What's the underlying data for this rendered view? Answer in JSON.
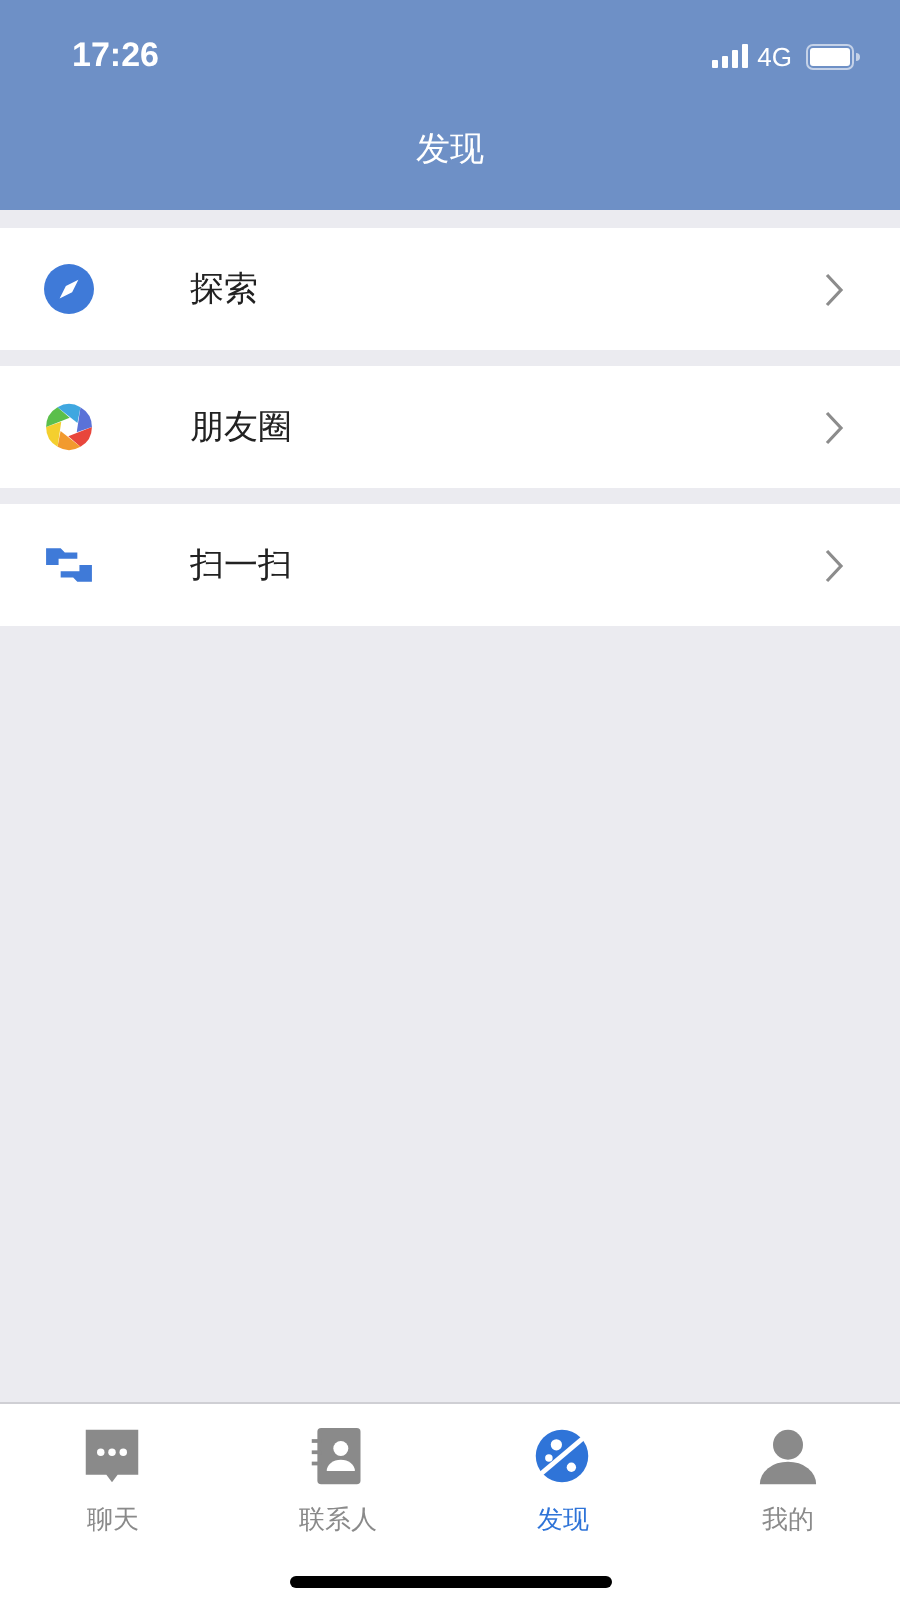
{
  "status_bar": {
    "time": "17:26",
    "network": "4G"
  },
  "title": "发现",
  "menu": [
    {
      "label": "探索",
      "kind": "compass"
    },
    {
      "label": "朋友圈",
      "kind": "aperture"
    },
    {
      "label": "扫一扫",
      "kind": "scan"
    }
  ],
  "tabs": [
    {
      "label": "聊天",
      "kind": "chat",
      "selected": false
    },
    {
      "label": "联系人",
      "kind": "contacts",
      "selected": false
    },
    {
      "label": "发现",
      "kind": "planet",
      "selected": true
    },
    {
      "label": "我的",
      "kind": "person",
      "selected": false
    }
  ]
}
